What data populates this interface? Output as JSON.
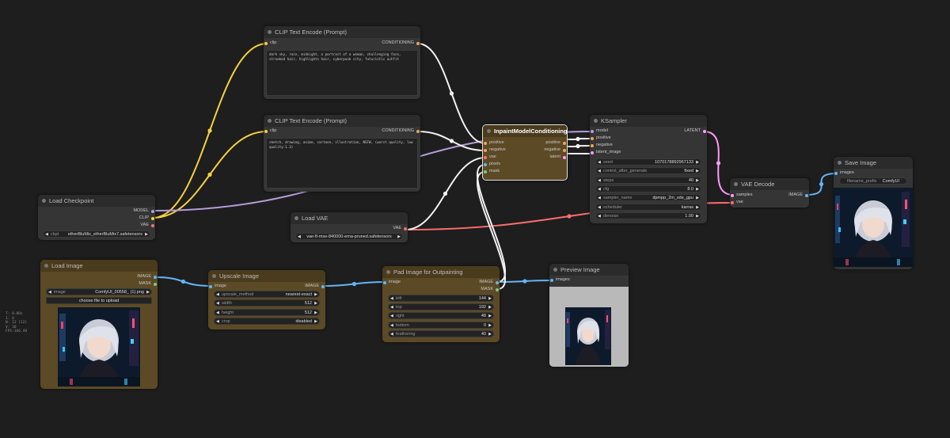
{
  "colors": {
    "model": "#b39ddb",
    "clip": "#f5d13c",
    "vae": "#ff6e6e",
    "conditioning": "#f0a550",
    "latent": "#ff9cf9",
    "image": "#64b5f6",
    "mask": "#81c784",
    "white_wire": "#f2f2f2"
  },
  "clip_encode_top": {
    "title": "CLIP Text Encode (Prompt)",
    "in_clip": "clip",
    "out_conditioning": "CONDITIONING",
    "text": "dark sky, rain, midnight, a portrait of a woman, challenging face, streaked hair, highlights hair, cyberpunk city, futuristic outfit"
  },
  "clip_encode_bottom": {
    "title": "CLIP Text Encode (Prompt)",
    "in_clip": "clip",
    "out_conditioning": "CONDITIONING",
    "text": "sketch, drawing, anime, cartoon, illustration, NSFW, (worst quality, low quality:1.3)"
  },
  "load_checkpoint": {
    "title": "Load Checkpoint",
    "out_model": "MODEL",
    "out_clip": "CLIP",
    "out_vae": "VAE",
    "ckpt_label": "ckpt",
    "ckpt_value": "etherBluMix_etherBluMix7.safetensors"
  },
  "load_vae": {
    "title": "Load VAE",
    "out_vae": "VAE",
    "vae_value": "vae-ft-mse-840000-ema-pruned.safetensors"
  },
  "inpaint": {
    "title": "InpaintModelConditioning",
    "in_positive": "positive",
    "in_negative": "negative",
    "in_vae": "vae",
    "in_pixels": "pixels",
    "in_mask": "mask",
    "out_positive": "positive",
    "out_negative": "negative",
    "out_latent": "latent"
  },
  "ksampler": {
    "title": "KSampler",
    "in_model": "model",
    "in_positive": "positive",
    "in_negative": "negative",
    "in_latent": "latent_image",
    "out_latent": "LATENT",
    "seed_label": "seed",
    "seed": "1070178892967133",
    "cag_label": "control_after_generate",
    "cag": "fixed",
    "steps_label": "steps",
    "steps": "40",
    "cfg_label": "cfg",
    "cfg": "8.0",
    "sampler_label": "sampler_name",
    "sampler": "dpmpp_2m_sde_gpu",
    "scheduler_label": "scheduler",
    "scheduler": "karras",
    "denoise_label": "denoise",
    "denoise": "1.00"
  },
  "vae_decode": {
    "title": "VAE Decode",
    "in_samples": "samples",
    "in_vae": "vae",
    "out_image": "IMAGE"
  },
  "save_image": {
    "title": "Save Image",
    "in_images": "images",
    "prefix_label": "filename_prefix",
    "prefix": "ComfyUI"
  },
  "load_image": {
    "title": "Load Image",
    "out_image": "IMAGE",
    "out_mask": "MASK",
    "image_label": "image",
    "image_value": "ComfyUI_00558_ (1).png",
    "upload_label": "choose file to upload"
  },
  "upscale": {
    "title": "Upscale Image",
    "in_image": "image",
    "out_image": "IMAGE",
    "method_label": "upscale_method",
    "method": "nearest-exact",
    "width_label": "width",
    "width": "512",
    "height_label": "height",
    "height": "512",
    "crop_label": "crop",
    "crop": "disabled"
  },
  "pad": {
    "title": "Pad Image for Outpainting",
    "in_image": "image",
    "out_image": "IMAGE",
    "out_mask": "MASK",
    "left_label": "left",
    "left": "144",
    "top_label": "top",
    "top": "192",
    "right_label": "right",
    "right": "48",
    "bottom_label": "bottom",
    "bottom": "0",
    "feathering_label": "feathering",
    "feathering": "40"
  },
  "preview": {
    "title": "Preview Image",
    "in_images": "images"
  },
  "stats": {
    "t": "T: 0.00s",
    "i": "I: 0",
    "n": "N: 12 [12]",
    "v": "V: 30",
    "fps": "FPS:166.48"
  }
}
